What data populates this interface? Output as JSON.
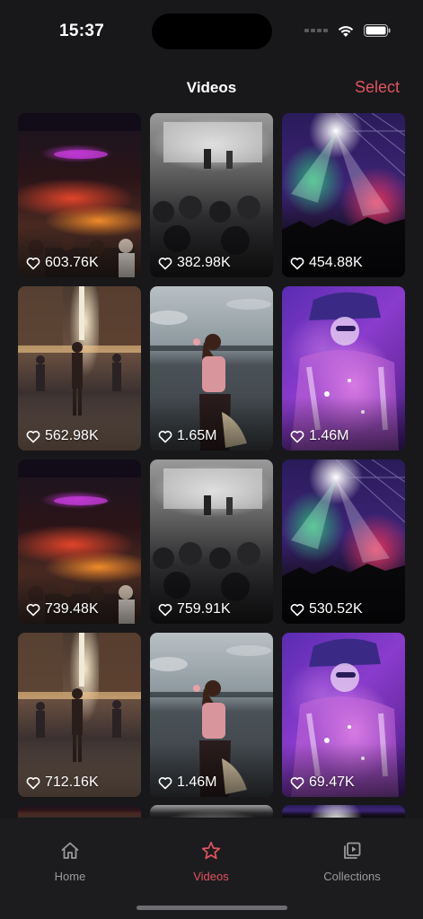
{
  "status_bar": {
    "time": "15:37"
  },
  "nav": {
    "title": "Videos",
    "select_label": "Select"
  },
  "videos": [
    {
      "likes": "603.76K",
      "art": "party"
    },
    {
      "likes": "382.98K",
      "art": "concert-bw"
    },
    {
      "likes": "454.88K",
      "art": "stage"
    },
    {
      "likes": "562.98K",
      "art": "street"
    },
    {
      "likes": "1.65M",
      "art": "beach"
    },
    {
      "likes": "1.46M",
      "art": "galaxy"
    },
    {
      "likes": "739.48K",
      "art": "party"
    },
    {
      "likes": "759.91K",
      "art": "concert-bw"
    },
    {
      "likes": "530.52K",
      "art": "stage"
    },
    {
      "likes": "712.16K",
      "art": "street"
    },
    {
      "likes": "1.46M",
      "art": "beach"
    },
    {
      "likes": "69.47K",
      "art": "galaxy"
    }
  ],
  "tab_bar": {
    "items": [
      {
        "label": "Home",
        "icon": "home-icon",
        "active": false
      },
      {
        "label": "Videos",
        "icon": "star-icon",
        "active": true
      },
      {
        "label": "Collections",
        "icon": "collections-icon",
        "active": false
      }
    ]
  },
  "colors": {
    "accent": "#e0545e",
    "background": "#18181a",
    "tab_bar": "#1c1c1e",
    "inactive": "#9a9a9e"
  }
}
